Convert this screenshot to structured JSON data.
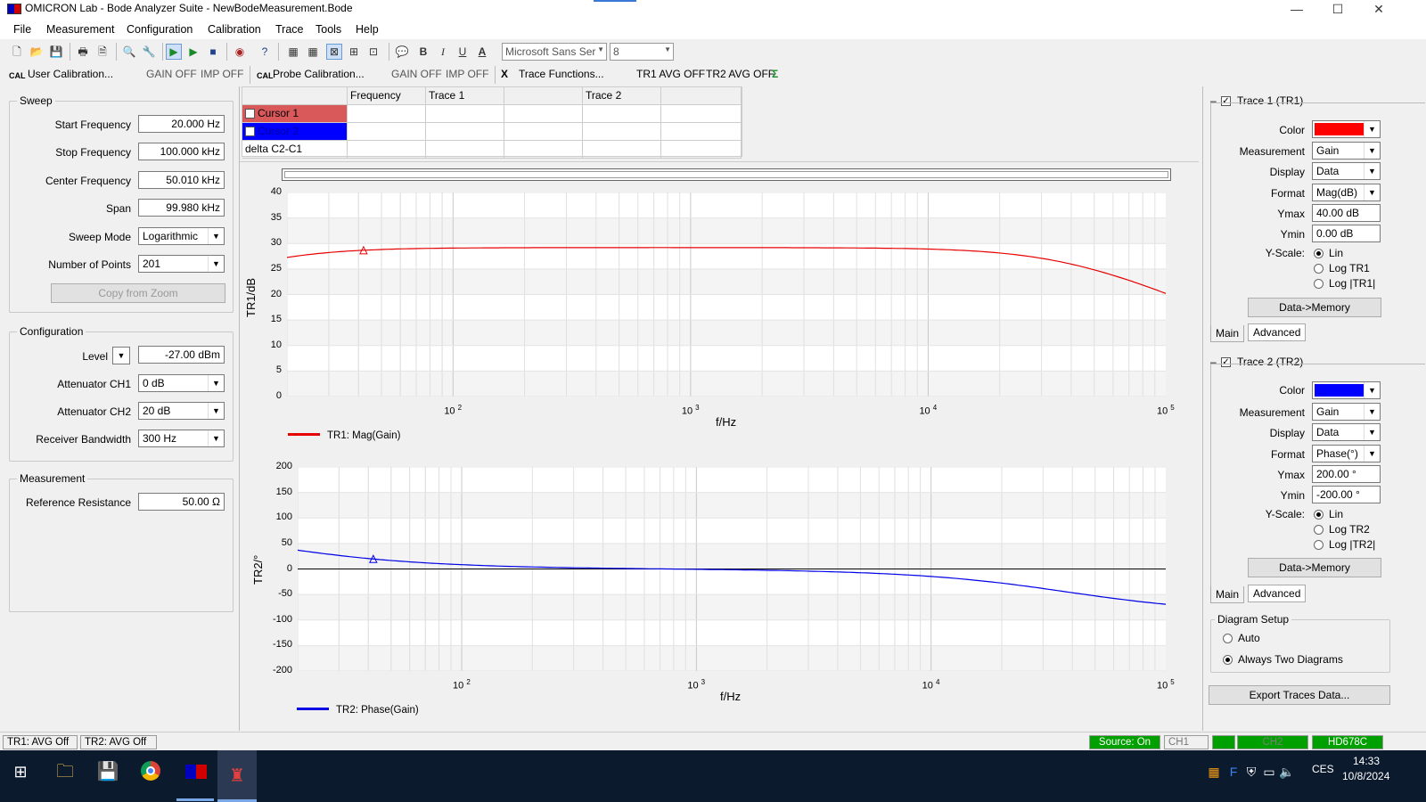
{
  "window": {
    "title": "OMICRON Lab - Bode Analyzer Suite - NewBodeMeasurement.Bode",
    "minimize": "—",
    "maximize": "☐",
    "close": "✕"
  },
  "menu": [
    "File",
    "Measurement",
    "Configuration",
    "Calibration",
    "Trace",
    "Tools",
    "Help"
  ],
  "toolbar": {
    "font_name": "Microsoft Sans Ser",
    "font_size": "8",
    "bold": "B",
    "italic": "I",
    "underline": "U",
    "font_color": "A"
  },
  "toolbar2": {
    "user_cal": "User Calibration...",
    "gain_off_1": "GAIN OFF",
    "imp_off_1": "IMP OFF",
    "probe_cal": "Probe Calibration...",
    "gain_off_2": "GAIN OFF",
    "imp_off_2": "IMP OFF",
    "trace_functions": "Trace Functions...",
    "tr1_avg": "TR1 AVG OFF",
    "tr2_avg": "TR2 AVG OFF"
  },
  "sweep": {
    "title": "Sweep",
    "start_label": "Start Frequency",
    "start_value": "20.000 Hz",
    "stop_label": "Stop Frequency",
    "stop_value": "100.000 kHz",
    "center_label": "Center Frequency",
    "center_value": "50.010 kHz",
    "span_label": "Span",
    "span_value": "99.980 kHz",
    "mode_label": "Sweep Mode",
    "mode_value": "Logarithmic",
    "points_label": "Number of Points",
    "points_value": "201",
    "copy_zoom": "Copy from Zoom"
  },
  "configuration": {
    "title": "Configuration",
    "level_label": "Level",
    "level_value": "-27.00 dBm",
    "att1_label": "Attenuator CH1",
    "att1_value": "0 dB",
    "att2_label": "Attenuator CH2",
    "att2_value": "20 dB",
    "rbw_label": "Receiver Bandwidth",
    "rbw_value": "300 Hz"
  },
  "measurement": {
    "title": "Measurement",
    "ref_label": "Reference Resistance",
    "ref_value": "50.00 Ω"
  },
  "cursor_table": {
    "headers": [
      "Frequency",
      "Trace 1",
      "Trace 2"
    ],
    "rows": [
      "Cursor 1",
      "Cursor 2",
      "delta C2-C1"
    ],
    "cursor1_color": "#d9595b",
    "cursor2_color": "#0000ff"
  },
  "plot1": {
    "ylabel": "TR1/dB",
    "xlabel": "f/Hz",
    "yticks": [
      "40",
      "35",
      "30",
      "25",
      "20",
      "15",
      "10",
      "5",
      "0"
    ],
    "xticks": [
      {
        "base": "10",
        "exp": "2"
      },
      {
        "base": "10",
        "exp": "3"
      },
      {
        "base": "10",
        "exp": "4"
      },
      {
        "base": "10",
        "exp": "5"
      }
    ],
    "legend": "TR1: Mag(Gain)",
    "color": "#e60000"
  },
  "plot2": {
    "ylabel": "TR2/°",
    "xlabel": "f/Hz",
    "yticks": [
      "200",
      "150",
      "100",
      "50",
      "0",
      "-50",
      "-100",
      "-150",
      "-200"
    ],
    "xticks": [
      {
        "base": "10",
        "exp": "2"
      },
      {
        "base": "10",
        "exp": "3"
      },
      {
        "base": "10",
        "exp": "4"
      },
      {
        "base": "10",
        "exp": "5"
      }
    ],
    "legend": "TR2: Phase(Gain)",
    "color": "#0000e6"
  },
  "trace1": {
    "title": "Trace 1 (TR1)",
    "color_label": "Color",
    "color": "#ff0000",
    "meas_label": "Measurement",
    "meas_value": "Gain",
    "display_label": "Display",
    "display_value": "Data",
    "format_label": "Format",
    "format_value": "Mag(dB)",
    "ymax_label": "Ymax",
    "ymax_value": "40.00 dB",
    "ymin_label": "Ymin",
    "ymin_value": "0.00 dB",
    "yscale_label": "Y-Scale:",
    "yscale_opts": [
      "Lin",
      "Log TR1",
      "Log |TR1|"
    ],
    "data_mem": "Data->Memory",
    "tab_main": "Main",
    "tab_adv": "Advanced"
  },
  "trace2": {
    "title": "Trace 2 (TR2)",
    "color_label": "Color",
    "color": "#0000ff",
    "meas_label": "Measurement",
    "meas_value": "Gain",
    "display_label": "Display",
    "display_value": "Data",
    "format_label": "Format",
    "format_value": "Phase(°)",
    "ymax_label": "Ymax",
    "ymax_value": "200.00 °",
    "ymin_label": "Ymin",
    "ymin_value": "-200.00 °",
    "yscale_label": "Y-Scale:",
    "yscale_opts": [
      "Lin",
      "Log TR2",
      "Log |TR2|"
    ],
    "data_mem": "Data->Memory",
    "tab_main": "Main",
    "tab_adv": "Advanced"
  },
  "diagram_setup": {
    "title": "Diagram Setup",
    "auto": "Auto",
    "two": "Always Two Diagrams",
    "export": "Export Traces Data..."
  },
  "status": {
    "tr1": "TR1:  AVG Off",
    "tr2": "TR2:  AVG Off",
    "source": "Source: On",
    "ch1": "CH1",
    "ch2": "CH2",
    "device": "HD678C"
  },
  "taskbar": {
    "lang": "CES",
    "time": "14:33",
    "date": "10/8/2024"
  }
}
